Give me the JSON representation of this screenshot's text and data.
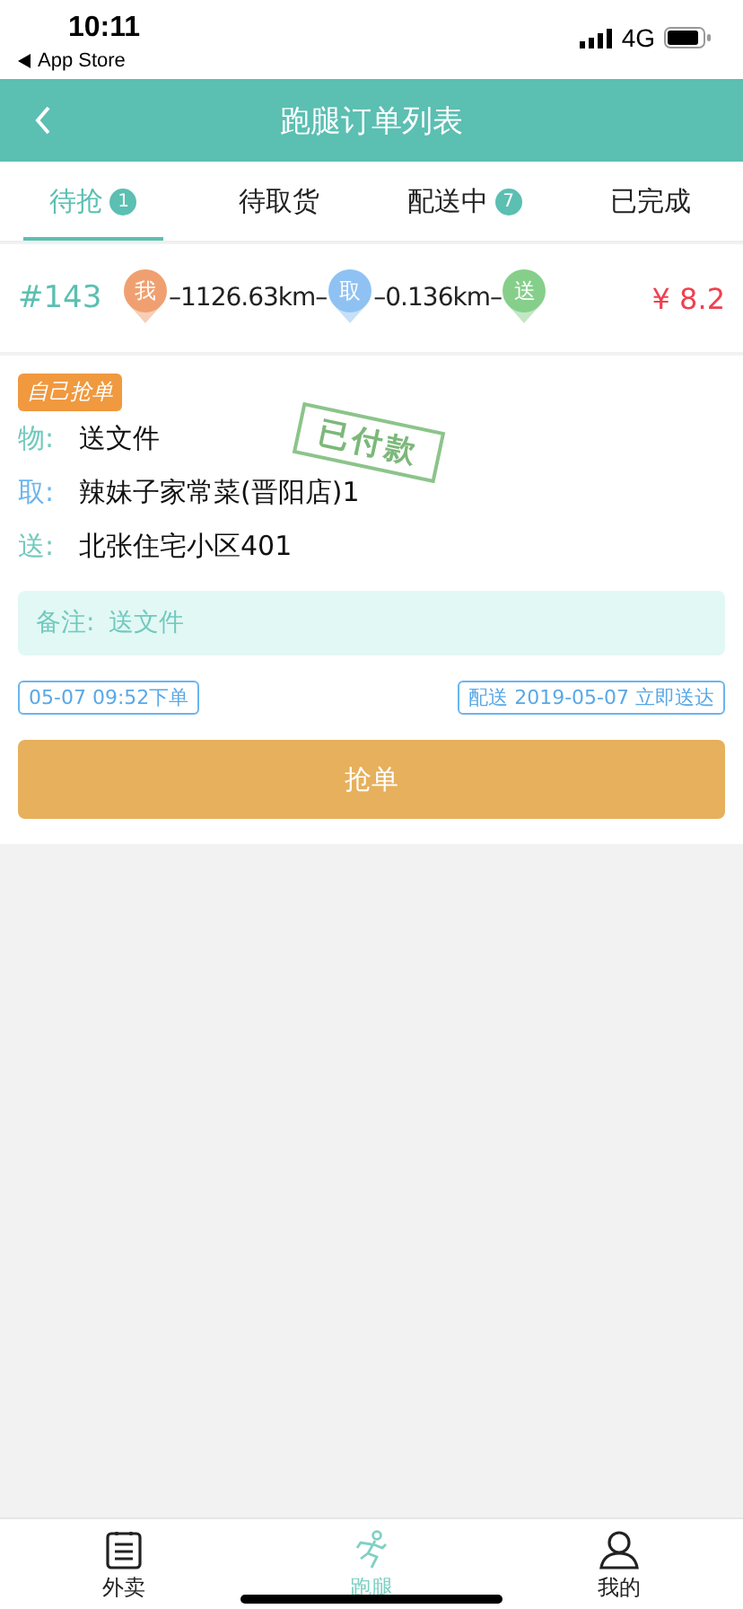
{
  "status_bar": {
    "time": "10:11",
    "back_app": "App Store",
    "network": "4G"
  },
  "header": {
    "title": "跑腿订单列表"
  },
  "tabs": [
    {
      "label": "待抢",
      "badge": "1",
      "selected": true
    },
    {
      "label": "待取货",
      "selected": false
    },
    {
      "label": "配送中",
      "badge": "7",
      "selected": false
    },
    {
      "label": "已完成",
      "selected": false
    }
  ],
  "order": {
    "number": "#143",
    "price": "¥ 8.2",
    "route": [
      {
        "kind": "pin",
        "label": "我",
        "color": "#f0a070"
      },
      {
        "kind": "distance",
        "text": "–1126.63km–"
      },
      {
        "kind": "pin",
        "label": "取",
        "color": "#8fc2f2"
      },
      {
        "kind": "distance",
        "text": "–0.136km–"
      },
      {
        "kind": "pin",
        "label": "送",
        "color": "#86cf8a"
      }
    ]
  },
  "card": {
    "tag": "自己抢单",
    "stamp": "已付款",
    "fields": [
      {
        "label": "物:",
        "value": "送文件",
        "color": "#72c9bd"
      },
      {
        "label": "取:",
        "value": "辣妹子家常菜(晋阳店)1",
        "color": "#6cb5ee"
      },
      {
        "label": "送:",
        "value": "北张住宅小区401",
        "color": "#72c9bd"
      }
    ],
    "note": {
      "label": "备注:",
      "value": "送文件"
    },
    "order_time": "05-07 09:52下单",
    "delivery": "配送 2019-05-07 立即送达",
    "button": "抢单"
  },
  "bottom_nav": [
    {
      "kind": "list",
      "label": "外卖",
      "selected": false
    },
    {
      "kind": "runner",
      "label": "跑腿",
      "selected": true
    },
    {
      "kind": "person",
      "label": "我的",
      "selected": false
    }
  ]
}
